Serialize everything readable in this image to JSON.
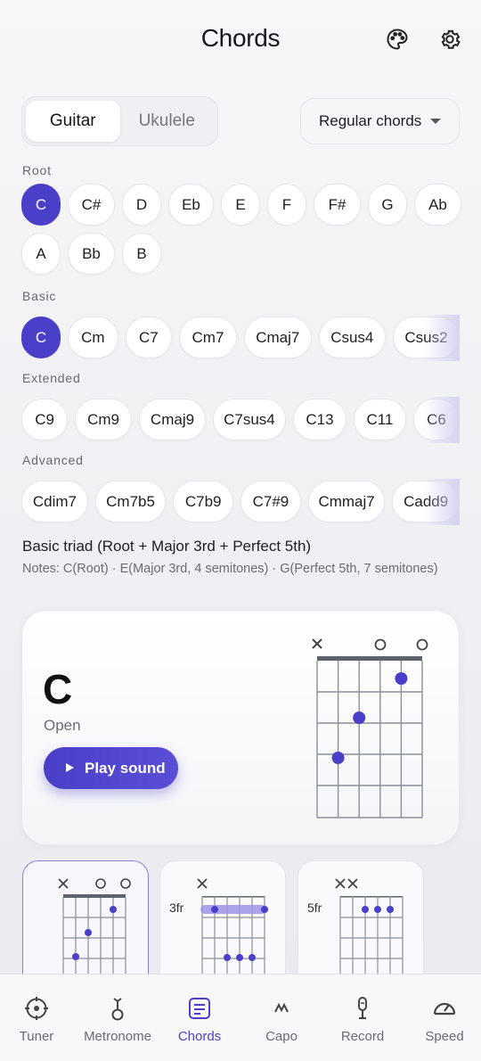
{
  "header": {
    "title": "Chords",
    "icons": [
      "palette-icon",
      "gear-icon"
    ]
  },
  "instrument_toggle": {
    "options": [
      "Guitar",
      "Ukulele"
    ],
    "selected": "Guitar"
  },
  "chord_set_dropdown": {
    "value": "Regular chords"
  },
  "sections": {
    "root": {
      "label": "Root",
      "items": [
        "C",
        "C#",
        "D",
        "Eb",
        "E",
        "F",
        "F#",
        "G",
        "Ab",
        "A",
        "Bb",
        "B"
      ],
      "selected": "C"
    },
    "basic": {
      "label": "Basic",
      "items": [
        "C",
        "Cm",
        "C7",
        "Cm7",
        "Cmaj7",
        "Csus4",
        "Csus2"
      ],
      "selected": "C"
    },
    "extended": {
      "label": "Extended",
      "items": [
        "C9",
        "Cm9",
        "Cmaj9",
        "C7sus4",
        "C13",
        "C11",
        "C6"
      ]
    },
    "advanced": {
      "label": "Advanced",
      "items": [
        "Cdim7",
        "Cm7b5",
        "C7b9",
        "C7#9",
        "Cmmaj7",
        "Cadd9"
      ]
    }
  },
  "description": {
    "title": "Basic triad (Root + Major 3rd + Perfect 5th)",
    "notes": "Notes: C(Root) · E(Major 3rd, 4 semitones) · G(Perfect 5th, 7 semitones)"
  },
  "chord_card": {
    "name": "C",
    "type": "Open",
    "play_label": "Play sound"
  },
  "voicings": [
    {
      "fret_label": "",
      "markers": "XOO"
    },
    {
      "fret_label": "3fr",
      "markers": "X"
    },
    {
      "fret_label": "5fr",
      "markers": "XX"
    }
  ],
  "tabs": [
    {
      "label": "Tuner",
      "icon": "tuner-icon",
      "active": false
    },
    {
      "label": "Metronome",
      "icon": "metronome-icon",
      "active": false
    },
    {
      "label": "Chords",
      "icon": "chords-icon",
      "active": true
    },
    {
      "label": "Capo",
      "icon": "capo-icon",
      "active": false
    },
    {
      "label": "Record",
      "icon": "microphone-icon",
      "active": false
    },
    {
      "label": "Speed",
      "icon": "speedometer-icon",
      "active": false
    }
  ],
  "colors": {
    "accent": "#4a3fc8",
    "text": "#1d1d22",
    "muted": "#6b6b73"
  }
}
